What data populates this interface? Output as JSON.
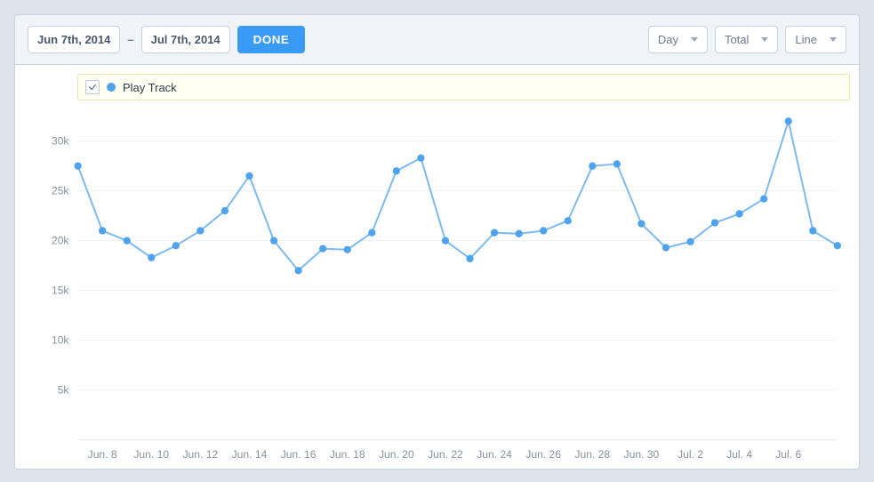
{
  "toolbar": {
    "date_start": "Jun 7th, 2014",
    "sep": "–",
    "date_end": "Jul 7th, 2014",
    "done_label": "DONE",
    "granularity": "Day",
    "aggregation": "Total",
    "chart_type": "Line"
  },
  "chart_data": {
    "type": "line",
    "title": "",
    "xlabel": "",
    "ylabel": "",
    "ylim": [
      0,
      33000
    ],
    "yticks": [
      5000,
      10000,
      15000,
      20000,
      25000,
      30000
    ],
    "ytick_labels": [
      "5k",
      "10k",
      "15k",
      "20k",
      "25k",
      "30k"
    ],
    "xticks_idx": [
      1,
      3,
      5,
      7,
      9,
      11,
      13,
      15,
      17,
      19,
      21,
      23,
      25,
      27,
      29
    ],
    "xtick_labels": [
      "Jun. 8",
      "Jun. 10",
      "Jun. 12",
      "Jun. 14",
      "Jun. 16",
      "Jun. 18",
      "Jun. 20",
      "Jun. 22",
      "Jun. 24",
      "Jun. 26",
      "Jun. 28",
      "Jun. 30",
      "Jul. 2",
      "Jul. 4",
      "Jul. 6"
    ],
    "categories": [
      "Jun 7",
      "Jun 8",
      "Jun 9",
      "Jun 10",
      "Jun 11",
      "Jun 12",
      "Jun 13",
      "Jun 14",
      "Jun 15",
      "Jun 16",
      "Jun 17",
      "Jun 18",
      "Jun 19",
      "Jun 20",
      "Jun 21",
      "Jun 22",
      "Jun 23",
      "Jun 24",
      "Jun 25",
      "Jun 26",
      "Jun 27",
      "Jun 28",
      "Jun 29",
      "Jun 30",
      "Jul 1",
      "Jul 2",
      "Jul 3",
      "Jul 4",
      "Jul 5",
      "Jul 6",
      "Jul 7"
    ],
    "series": [
      {
        "name": "Play Track",
        "values": [
          27500,
          21000,
          20000,
          18300,
          19500,
          21000,
          23000,
          26500,
          20000,
          17000,
          19200,
          19100,
          20800,
          27000,
          28300,
          20000,
          18200,
          20800,
          20700,
          21000,
          22000,
          27500,
          27700,
          21700,
          19300,
          19900,
          21800,
          22700,
          24200,
          32000,
          21000,
          19500
        ]
      }
    ],
    "colors": {
      "line": "#7fbaf0",
      "point": "#4fa3ee"
    }
  }
}
